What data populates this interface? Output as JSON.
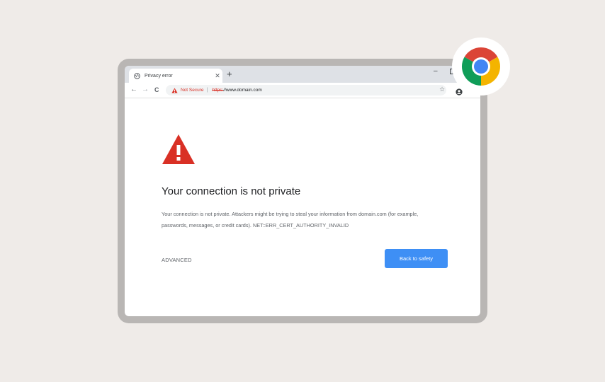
{
  "browser": {
    "tab": {
      "title": "Privacy error",
      "close_symbol": "✕"
    },
    "new_tab_symbol": "+",
    "window": {
      "minimize_symbol": "–"
    },
    "toolbar": {
      "back_symbol": "←",
      "forward_symbol": "→",
      "reload_symbol": "C",
      "security_label": "Not Secure",
      "separator": "|",
      "url_scheme": "https:",
      "url_rest": "//www.domain.com",
      "bookmark_symbol": "☆"
    }
  },
  "page": {
    "heading": "Your connection is not private",
    "description": "Your connection is not private. Attackers might be trying to steal your information from domain.com (for example, passwords, messages, or credit cards). NET::ERR_CERT_AUTHORITY_INVALID",
    "advanced_label": "ADVANCED",
    "back_button_label": "Back to safety"
  },
  "colors": {
    "page_background": "#efebe8",
    "device_frame": "#b9b6b4",
    "warning_red": "#d93025",
    "primary_button": "#3e8ff5",
    "tabstrip": "#dee1e6"
  },
  "icons": [
    "globe-icon",
    "warning-icon",
    "star-icon",
    "profile-icon",
    "chrome-logo"
  ]
}
